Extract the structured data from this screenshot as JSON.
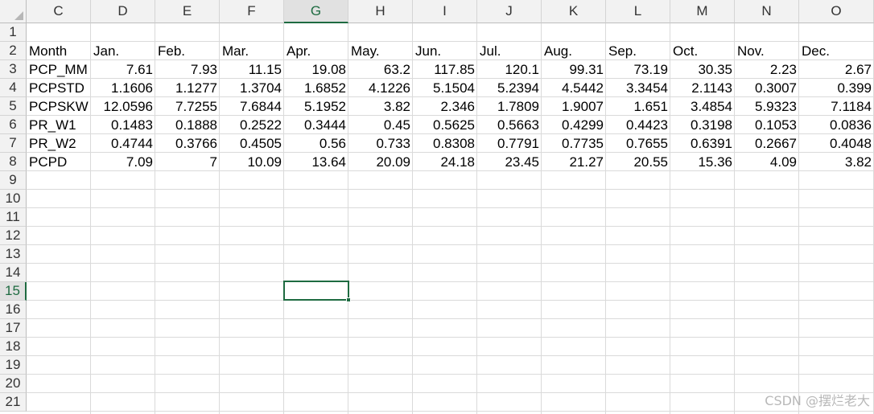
{
  "columns": [
    "C",
    "D",
    "E",
    "F",
    "G",
    "H",
    "I",
    "J",
    "K",
    "L",
    "M",
    "N",
    "O"
  ],
  "selected_column": "G",
  "rows": [
    "1",
    "2",
    "3",
    "4",
    "5",
    "6",
    "7",
    "8",
    "9",
    "10",
    "11",
    "12",
    "13",
    "14",
    "15",
    "16",
    "17",
    "18",
    "19",
    "20",
    "21"
  ],
  "selected_row": "15",
  "table": {
    "header": [
      "Month",
      "Jan.",
      "Feb.",
      "Mar.",
      "Apr.",
      "May.",
      "Jun.",
      "Jul.",
      "Aug.",
      "Sep.",
      "Oct.",
      "Nov.",
      "Dec."
    ],
    "body": [
      [
        "PCP_MM",
        "7.61",
        "7.93",
        "11.15",
        "19.08",
        "63.2",
        "117.85",
        "120.1",
        "99.31",
        "73.19",
        "30.35",
        "2.23",
        "2.67"
      ],
      [
        "PCPSTD",
        "1.1606",
        "1.1277",
        "1.3704",
        "1.6852",
        "4.1226",
        "5.1504",
        "5.2394",
        "4.5442",
        "3.3454",
        "2.1143",
        "0.3007",
        "0.399"
      ],
      [
        "PCPSKW",
        "12.0596",
        "7.7255",
        "7.6844",
        "5.1952",
        "3.82",
        "2.346",
        "1.7809",
        "1.9007",
        "1.651",
        "3.4854",
        "5.9323",
        "7.1184"
      ],
      [
        "PR_W1",
        "0.1483",
        "0.1888",
        "0.2522",
        "0.3444",
        "0.45",
        "0.5625",
        "0.5663",
        "0.4299",
        "0.4423",
        "0.3198",
        "0.1053",
        "0.0836"
      ],
      [
        "PR_W2",
        "0.4744",
        "0.3766",
        "0.4505",
        "0.56",
        "0.733",
        "0.8308",
        "0.7791",
        "0.7735",
        "0.7655",
        "0.6391",
        "0.2667",
        "0.4048"
      ],
      [
        "PCPD",
        "7.09",
        "7",
        "10.09",
        "13.64",
        "20.09",
        "24.18",
        "23.45",
        "21.27",
        "20.55",
        "15.36",
        "4.09",
        "3.82"
      ]
    ]
  },
  "active_cell": "G15",
  "watermark": "CSDN @摆烂老大",
  "colors": {
    "accent": "#1e6b41",
    "header_bg": "#f2f2f2",
    "grid": "#dadada"
  }
}
